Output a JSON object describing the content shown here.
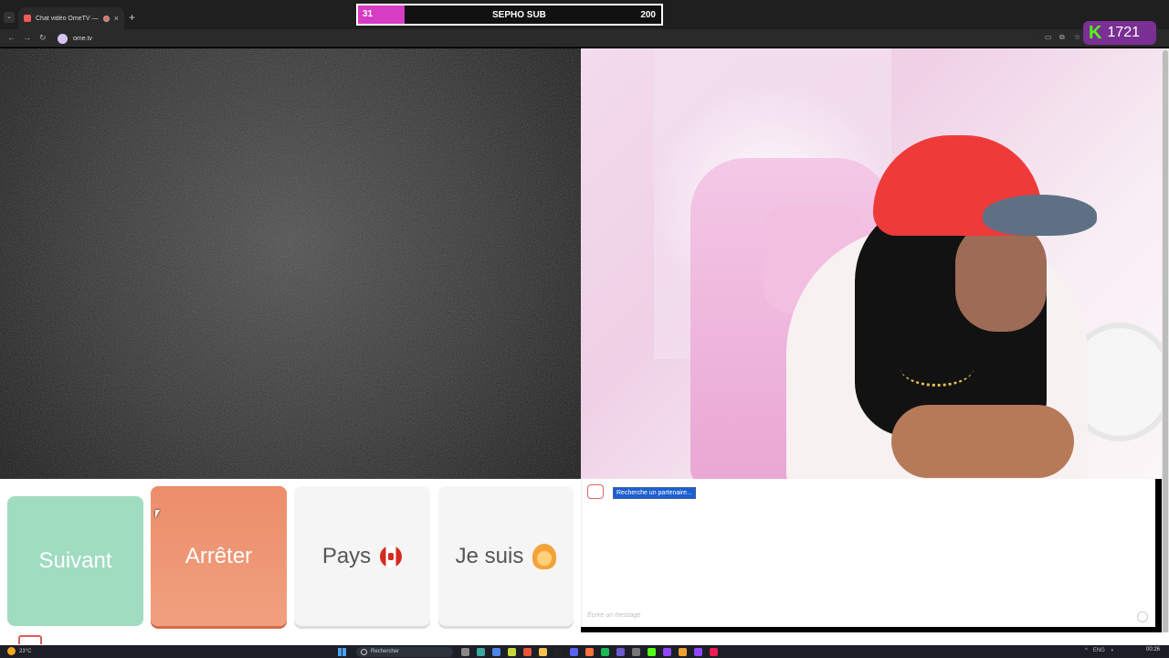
{
  "browser": {
    "tab_title": "Chat vidéo OmeTV — Alter...",
    "url": "ome.tv",
    "new_tab_symbol": "+"
  },
  "overlay": {
    "sub_goal_current": "31",
    "sub_goal_label": "SEPHO SUB",
    "sub_goal_target": "200",
    "sub_goal_progress": 0.155,
    "kick_logo": "K",
    "kick_viewers": "1721",
    "kick_color": "#53fc18",
    "goal_color": "#d63cc4"
  },
  "controls": {
    "next_label": "Suivant",
    "stop_label": "Arrêter",
    "country_label": "Pays",
    "country_flag": "flag-canada-icon",
    "gender_label": "Je suis",
    "gender_icon": "woman-emoji-icon"
  },
  "chat": {
    "status_message": "Recherche un partenaire...",
    "input_placeholder": "Écrire un message"
  },
  "taskbar": {
    "temperature": "23°C",
    "search_placeholder": "Rechercher",
    "language": "ENG",
    "time": "00:26"
  }
}
